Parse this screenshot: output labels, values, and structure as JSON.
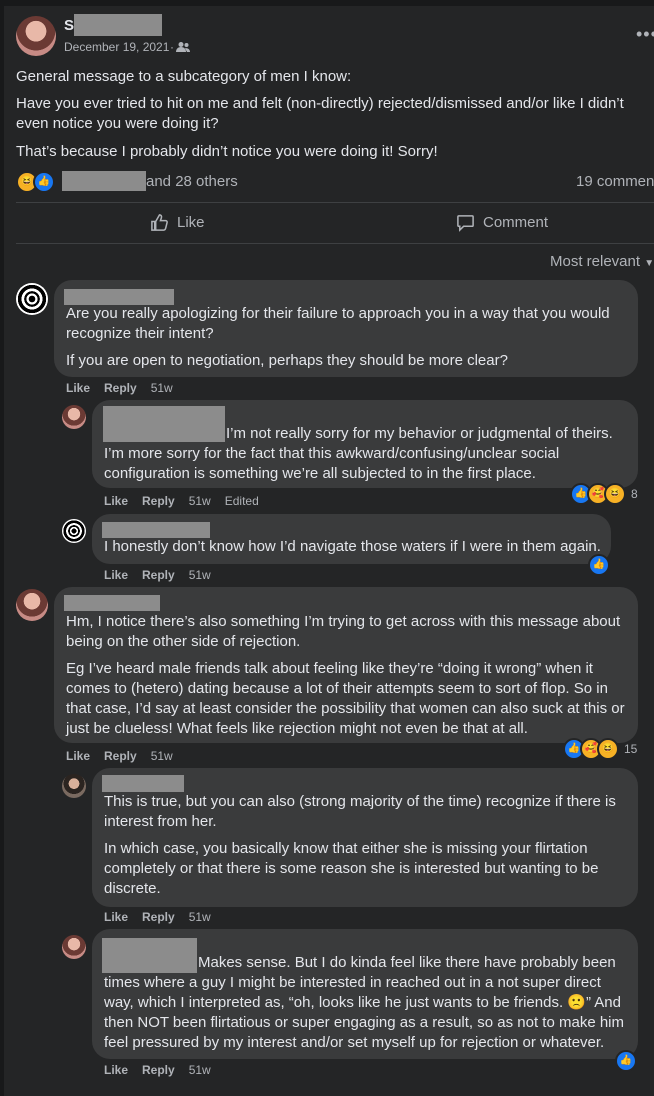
{
  "post": {
    "author_initial": "S",
    "date": "December 19, 2021",
    "audience_icon": "friends-icon",
    "menu_icon": "more-icon",
    "paragraphs": [
      "General message to a subcategory of men I know:",
      "Have you ever tried to hit on me and felt (non-directly) rejected/dismissed and/or like I didn’t even notice you were doing it?",
      "That’s because I probably didn’t notice you were doing it! Sorry!"
    ],
    "reactions_text": "and 28 others",
    "comments_count": "19 commen",
    "like_label": "Like",
    "comment_label": "Comment",
    "sort_label": "Most relevant"
  },
  "comments": [
    {
      "lines": [
        "Are you really apologizing for their failure to approach you in a way that you would",
        "recognize their intent?"
      ],
      "lines2": [
        "If you are open to negotiation, perhaps they should be more clear?"
      ],
      "like": "Like",
      "reply": "Reply",
      "time": "51w"
    },
    {
      "first_line": "I’m not really sorry for my behavior or judgmental of theirs.",
      "lines": [
        "I’m more sorry for the fact that this awkward/confusing/unclear social",
        "configuration is something we’re all subjected to in the first place."
      ],
      "like": "Like",
      "reply": "Reply",
      "time": "51w",
      "edited": "Edited",
      "reaction_count": "8"
    },
    {
      "lines": [
        "I honestly don’t know how I’d navigate those waters if I were in them again."
      ],
      "like": "Like",
      "reply": "Reply",
      "time": "51w"
    },
    {
      "lines": [
        "Hm, I notice there’s also something I’m trying to get across with this message about",
        "being on the other side of rejection."
      ],
      "lines2": [
        "Eg I’ve heard male friends talk about feeling like they’re “doing it wrong” when it",
        "comes to (hetero) dating because a lot of their attempts seem to sort of flop. So in",
        "that case, I’d say at least consider the possibility that women can also suck at this or",
        "just be clueless! What feels like rejection might not even be that at all."
      ],
      "like": "Like",
      "reply": "Reply",
      "time": "51w",
      "reaction_count": "15"
    },
    {
      "lines": [
        "This is true, but you can also (strong majority of the time) recognize if there is",
        "interest from her."
      ],
      "lines2": [
        "In which case, you basically know that either she is missing your flirtation",
        "completely or that there is some reason she is interested but wanting to be",
        "discrete."
      ],
      "like": "Like",
      "reply": "Reply",
      "time": "51w"
    },
    {
      "first_line": "Makes sense. But I do kinda feel like there have probably been",
      "lines": [
        "times where a guy I might be interested in reached out in a not super direct",
        "way, which I interpreted as, “oh, looks like he just wants to be friends. 🙁” And",
        "then NOT been flirtatious or super engaging as a result, so as not to make him",
        "feel pressured by my interest and/or set myself up for rejection or whatever."
      ],
      "like": "Like",
      "reply": "Reply",
      "time": "51w"
    }
  ],
  "colors": {
    "background": "#18191a",
    "card": "#242526",
    "bubble": "#3a3b3c",
    "accent": "#1877f2",
    "muted": "#b0b3b8"
  }
}
